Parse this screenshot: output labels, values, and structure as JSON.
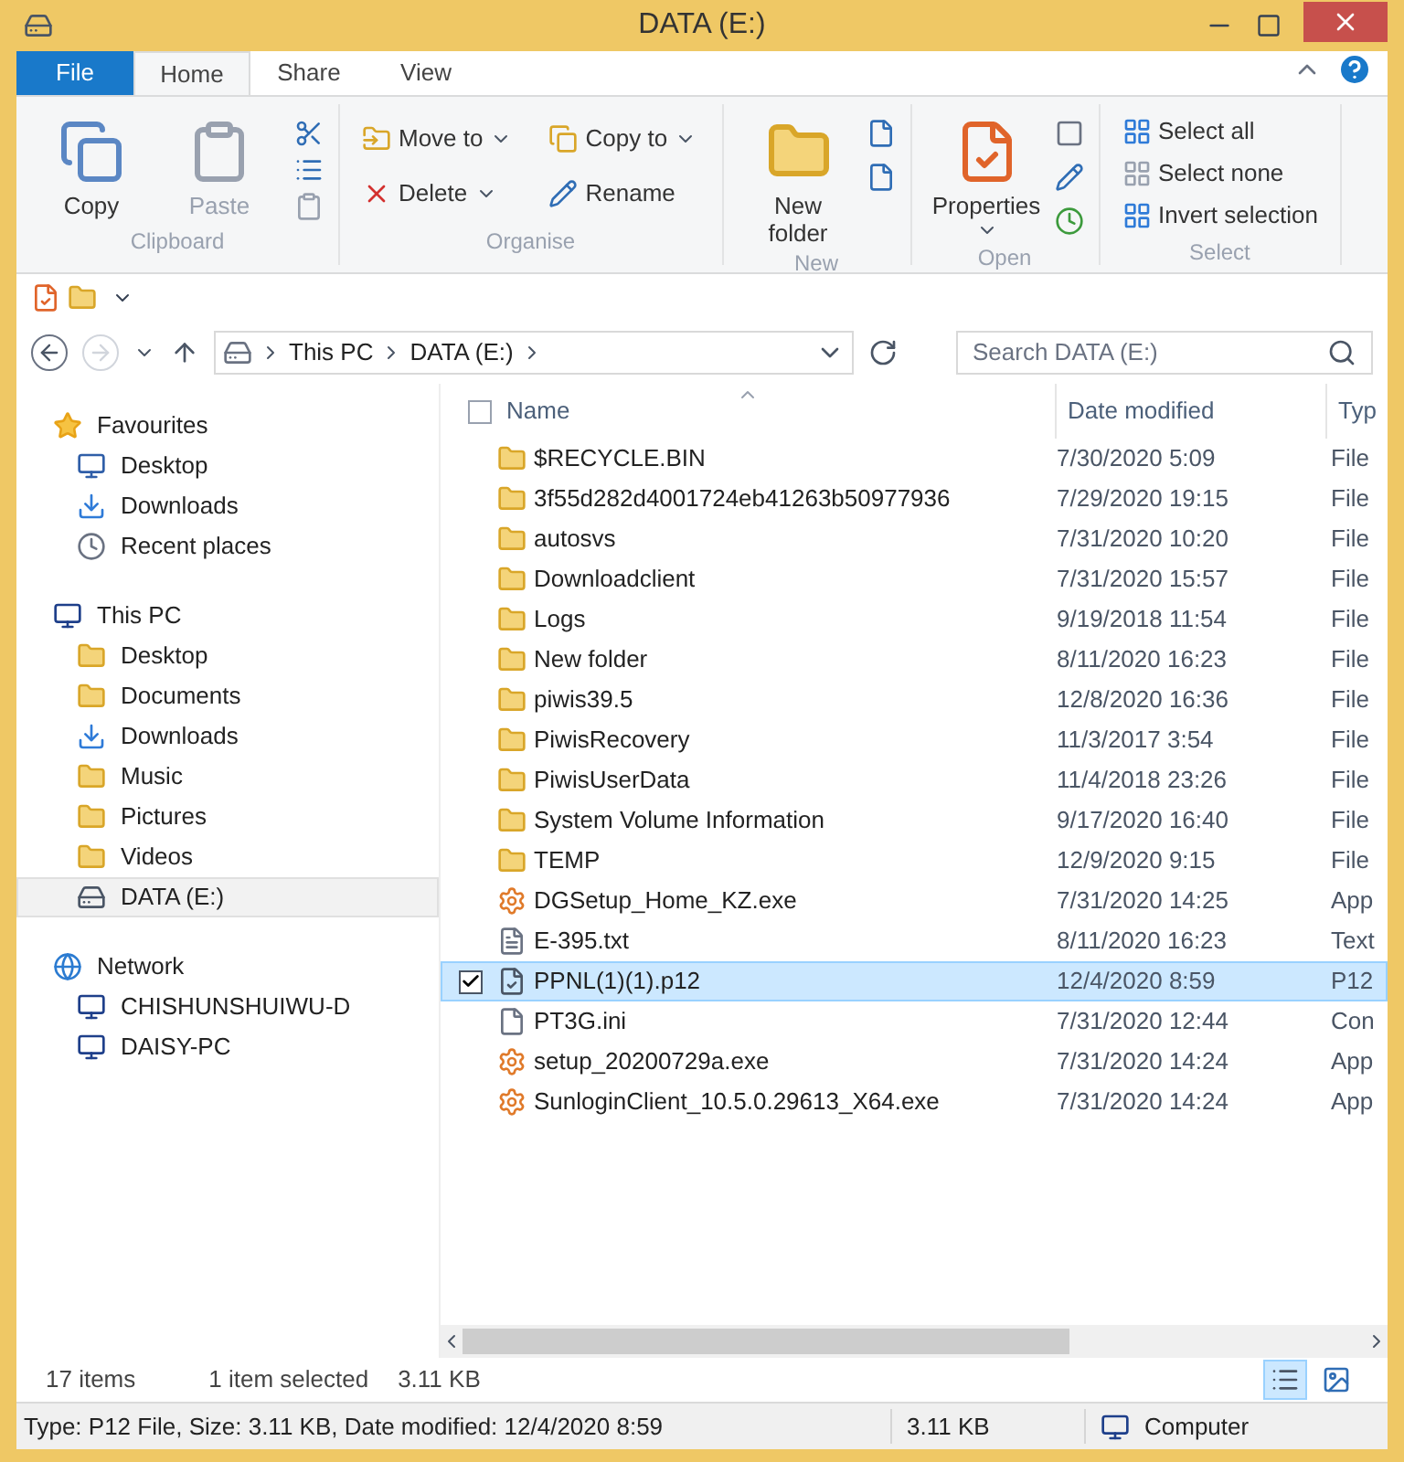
{
  "window": {
    "title": "DATA (E:)"
  },
  "ribbon_tabs": [
    {
      "label": "File",
      "kind": "file",
      "selected": false
    },
    {
      "label": "Home",
      "kind": "tab",
      "selected": true
    },
    {
      "label": "Share",
      "kind": "tab",
      "selected": false
    },
    {
      "label": "View",
      "kind": "tab",
      "selected": false
    }
  ],
  "ribbon_groups": [
    {
      "label": "Clipboard",
      "buttons": [
        {
          "label": "Copy",
          "kind": "large",
          "disabled": false,
          "dropdown": false
        },
        {
          "label": "Paste",
          "kind": "large",
          "disabled": true,
          "dropdown": false
        }
      ]
    },
    {
      "label": "Organise",
      "buttons": [
        {
          "label": "Move to",
          "kind": "small",
          "disabled": false,
          "dropdown": true
        },
        {
          "label": "Copy to",
          "kind": "small",
          "disabled": false,
          "dropdown": true
        },
        {
          "label": "Delete",
          "kind": "small",
          "disabled": false,
          "dropdown": true
        },
        {
          "label": "Rename",
          "kind": "small",
          "disabled": false,
          "dropdown": false
        }
      ]
    },
    {
      "label": "New",
      "buttons": [
        {
          "label": "New folder",
          "kind": "large",
          "disabled": false,
          "dropdown": false
        }
      ]
    },
    {
      "label": "Open",
      "buttons": [
        {
          "label": "Properties",
          "kind": "large",
          "disabled": false,
          "dropdown": true
        }
      ]
    },
    {
      "label": "Select",
      "buttons": [
        {
          "label": "Select all",
          "kind": "small",
          "disabled": false,
          "dropdown": false
        },
        {
          "label": "Select none",
          "kind": "small",
          "disabled": false,
          "dropdown": false
        },
        {
          "label": "Invert selection",
          "kind": "small",
          "disabled": false,
          "dropdown": false
        }
      ]
    }
  ],
  "address": {
    "breadcrumb": [
      "This PC",
      "DATA (E:)"
    ]
  },
  "search": {
    "placeholder": "Search DATA (E:)"
  },
  "sidebar": [
    {
      "label": "Favourites",
      "kind": "favourites",
      "children": [
        {
          "label": "Desktop",
          "kind": "desktop",
          "selected": false
        },
        {
          "label": "Downloads",
          "kind": "downloads",
          "selected": false
        },
        {
          "label": "Recent places",
          "kind": "recent",
          "selected": false
        }
      ]
    },
    {
      "label": "This PC",
      "kind": "pc",
      "children": [
        {
          "label": "Desktop",
          "kind": "folder",
          "selected": false
        },
        {
          "label": "Documents",
          "kind": "folder",
          "selected": false
        },
        {
          "label": "Downloads",
          "kind": "downloads",
          "selected": false
        },
        {
          "label": "Music",
          "kind": "folder",
          "selected": false
        },
        {
          "label": "Pictures",
          "kind": "folder",
          "selected": false
        },
        {
          "label": "Videos",
          "kind": "folder",
          "selected": false
        },
        {
          "label": "DATA (E:)",
          "kind": "drive",
          "selected": true
        }
      ]
    },
    {
      "label": "Network",
      "kind": "network",
      "children": [
        {
          "label": "CHISHUNSHUIWU-D",
          "kind": "computer",
          "selected": false
        },
        {
          "label": "DAISY-PC",
          "kind": "computer",
          "selected": false
        }
      ]
    }
  ],
  "table": {
    "select_all": {
      "checked": false
    },
    "columns": [
      "Name",
      "Date modified",
      "Typ"
    ],
    "rows": [
      {
        "name": "$RECYCLE.BIN",
        "date": "7/30/2020 5:09",
        "type": "File",
        "kind": "folder",
        "selected": false
      },
      {
        "name": "3f55d282d4001724eb41263b50977936",
        "date": "7/29/2020 19:15",
        "type": "File",
        "kind": "folder",
        "selected": false
      },
      {
        "name": "autosvs",
        "date": "7/31/2020 10:20",
        "type": "File",
        "kind": "folder",
        "selected": false
      },
      {
        "name": "Downloadclient",
        "date": "7/31/2020 15:57",
        "type": "File",
        "kind": "folder",
        "selected": false
      },
      {
        "name": "Logs",
        "date": "9/19/2018 11:54",
        "type": "File",
        "kind": "folder",
        "selected": false
      },
      {
        "name": "New folder",
        "date": "8/11/2020 16:23",
        "type": "File",
        "kind": "folder",
        "selected": false
      },
      {
        "name": "piwis39.5",
        "date": "12/8/2020 16:36",
        "type": "File",
        "kind": "folder",
        "selected": false
      },
      {
        "name": "PiwisRecovery",
        "date": "11/3/2017 3:54",
        "type": "File",
        "kind": "folder",
        "selected": false
      },
      {
        "name": "PiwisUserData",
        "date": "11/4/2018 23:26",
        "type": "File",
        "kind": "folder",
        "selected": false
      },
      {
        "name": "System Volume Information",
        "date": "9/17/2020 16:40",
        "type": "File",
        "kind": "folder",
        "selected": false
      },
      {
        "name": "TEMP",
        "date": "12/9/2020 9:15",
        "type": "File",
        "kind": "folder",
        "selected": false
      },
      {
        "name": "DGSetup_Home_KZ.exe",
        "date": "7/31/2020 14:25",
        "type": "App",
        "kind": "exe",
        "selected": false
      },
      {
        "name": "E-395.txt",
        "date": "8/11/2020 16:23",
        "type": "Text",
        "kind": "txt",
        "selected": false
      },
      {
        "name": "PPNL(1)(1).p12",
        "date": "12/4/2020 8:59",
        "type": "P12",
        "kind": "cert",
        "selected": true
      },
      {
        "name": "PT3G.ini",
        "date": "7/31/2020 12:44",
        "type": "Con",
        "kind": "ini",
        "selected": false
      },
      {
        "name": "setup_20200729a.exe",
        "date": "7/31/2020 14:24",
        "type": "App",
        "kind": "exe",
        "selected": false
      },
      {
        "name": "SunloginClient_10.5.0.29613_X64.exe",
        "date": "7/31/2020 14:24",
        "type": "App",
        "kind": "exe",
        "selected": false
      }
    ]
  },
  "status": {
    "items": "17 items",
    "selection": "1 item selected",
    "size": "3.11 KB",
    "views": [
      {
        "kind": "details",
        "selected": true
      },
      {
        "kind": "tiles",
        "selected": false
      }
    ]
  },
  "status_bar": {
    "details": "Type: P12 File, Size: 3.11 KB, Date modified: 12/4/2020 8:59",
    "size": "3.11 KB",
    "location": "Computer"
  }
}
